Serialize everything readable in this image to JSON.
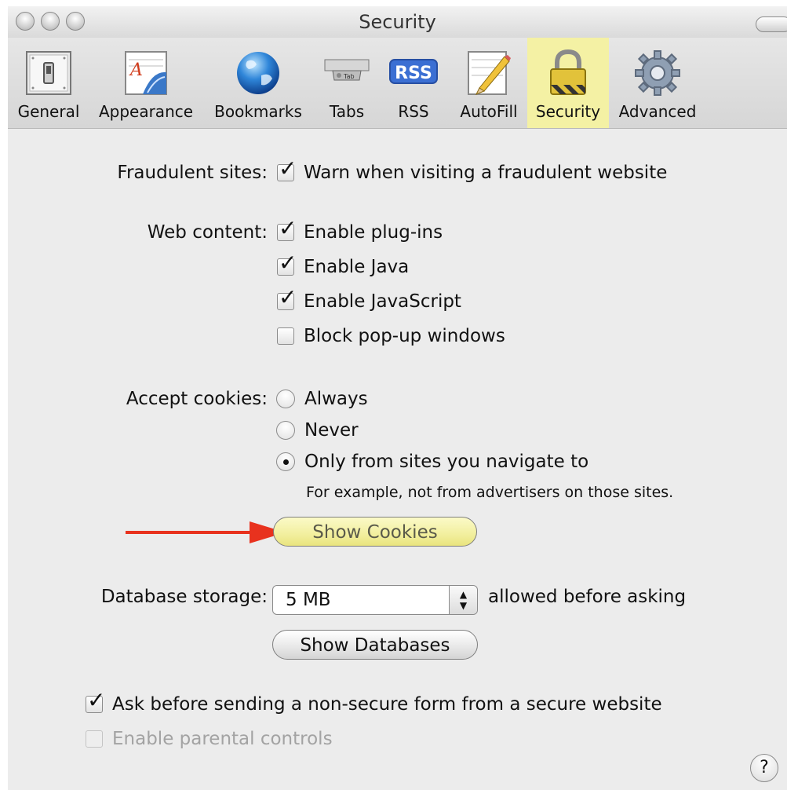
{
  "window": {
    "title": "Security"
  },
  "toolbar": {
    "items": [
      {
        "label": "General",
        "icon": "switch-icon"
      },
      {
        "label": "Appearance",
        "icon": "font-icon"
      },
      {
        "label": "Bookmarks",
        "icon": "globe-icon"
      },
      {
        "label": "Tabs",
        "icon": "tab-icon"
      },
      {
        "label": "RSS",
        "icon": "rss-icon"
      },
      {
        "label": "AutoFill",
        "icon": "pencil-icon"
      },
      {
        "label": "Security",
        "icon": "lock-icon",
        "selected": true
      },
      {
        "label": "Advanced",
        "icon": "gear-icon"
      }
    ],
    "rss_badge": "RSS",
    "tab_badge": "Tab"
  },
  "fraudulent": {
    "label": "Fraudulent sites:",
    "warn_label": "Warn when visiting a fraudulent website",
    "warn_checked": true
  },
  "web_content": {
    "label": "Web content:",
    "options": [
      {
        "label": "Enable plug-ins",
        "checked": true
      },
      {
        "label": "Enable Java",
        "checked": true
      },
      {
        "label": "Enable JavaScript",
        "checked": true
      },
      {
        "label": "Block pop-up windows",
        "checked": false
      }
    ]
  },
  "cookies": {
    "label": "Accept cookies:",
    "options": [
      {
        "label": "Always",
        "selected": false
      },
      {
        "label": "Never",
        "selected": false
      },
      {
        "label": "Only from sites you navigate to",
        "selected": true
      }
    ],
    "note": "For example, not from advertisers on those sites.",
    "show_button": "Show Cookies"
  },
  "database": {
    "label": "Database storage:",
    "value": "5 MB",
    "suffix": "allowed before asking",
    "show_button": "Show Databases"
  },
  "form_warning": {
    "label": "Ask before sending a non-secure form from a secure website",
    "checked": true
  },
  "parental": {
    "label": "Enable parental controls",
    "checked": false,
    "disabled": true
  },
  "help": {
    "label": "?"
  },
  "colors": {
    "selected_tab": "#f4f1a4",
    "highlight_button": "#f2ef9e",
    "arrow": "#e8321e"
  }
}
